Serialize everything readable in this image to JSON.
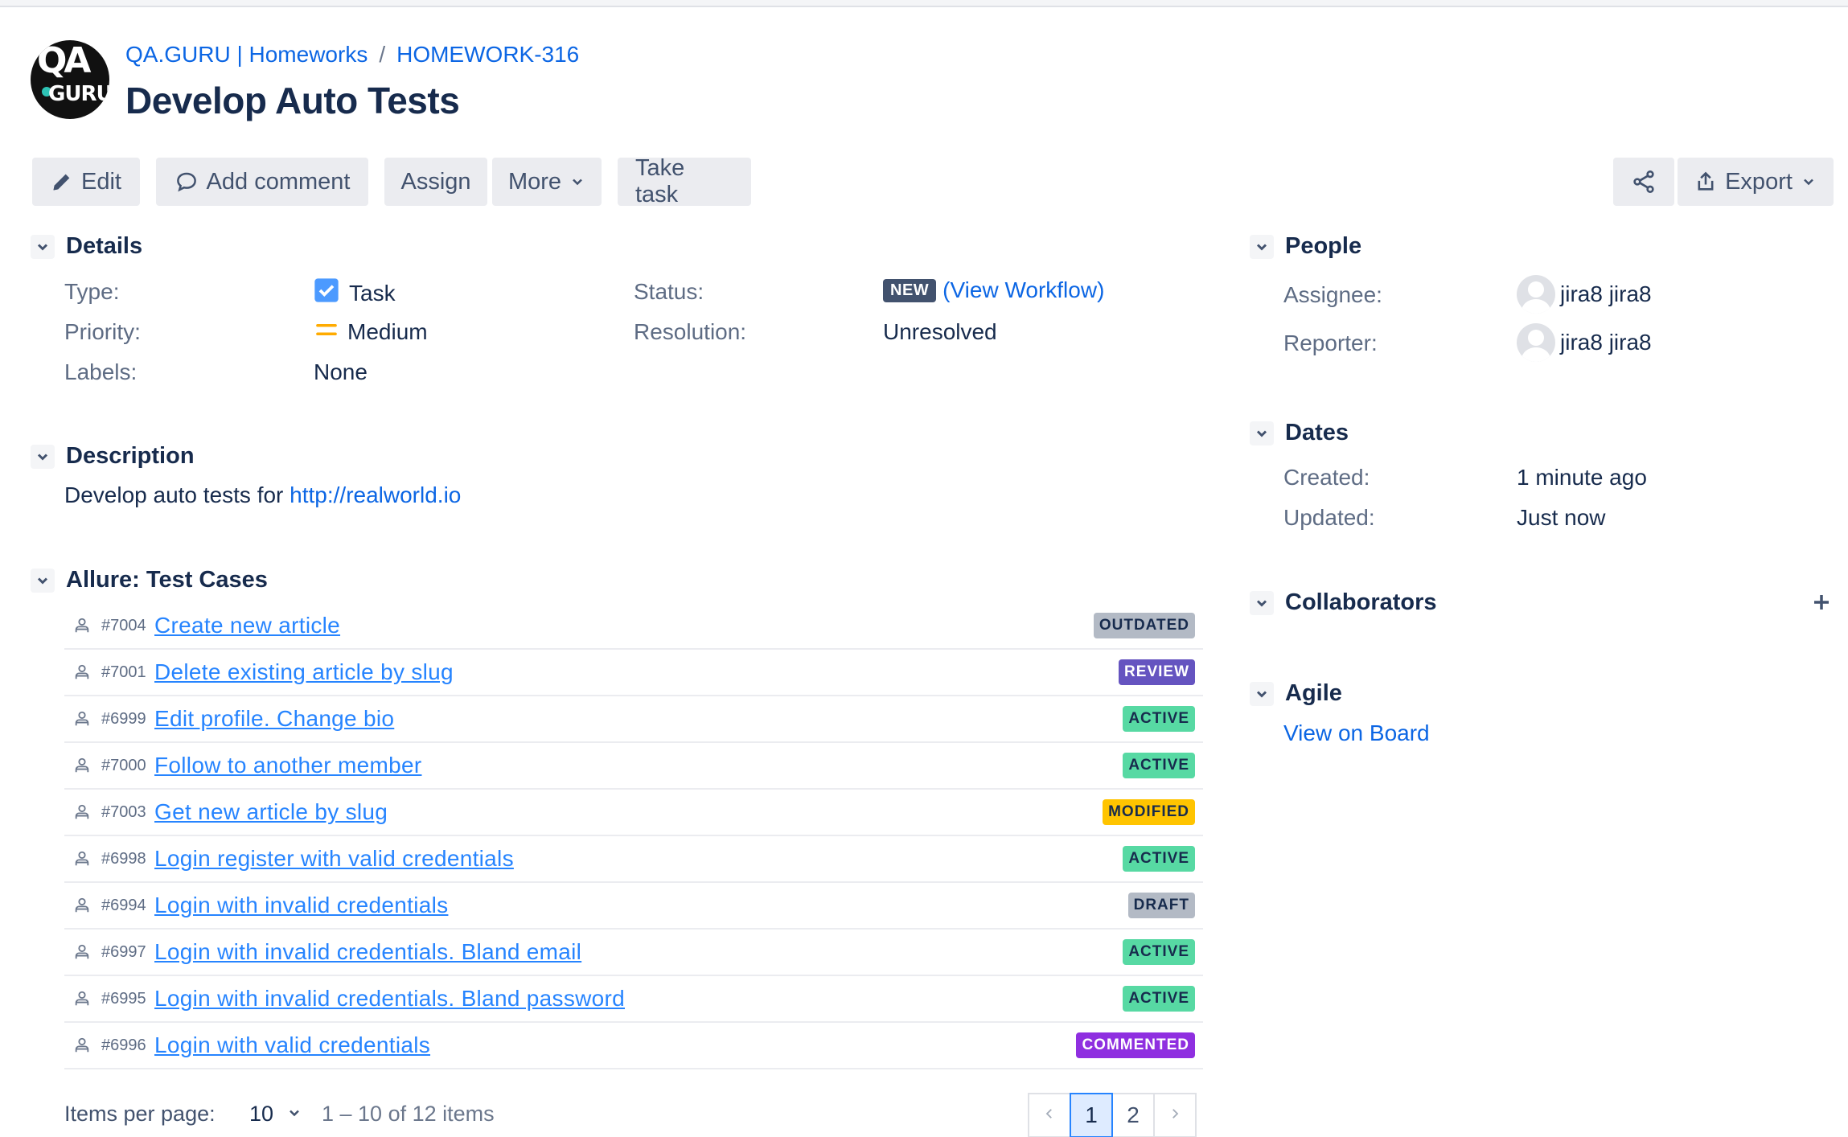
{
  "breadcrumb": {
    "project": "QA.GURU | Homeworks",
    "separator": "/",
    "issue_key": "HOMEWORK-316"
  },
  "project_avatar": {
    "text_top": "QA",
    "text_bottom": "GURU"
  },
  "title": "Develop Auto Tests",
  "toolbar": {
    "edit": "Edit",
    "add_comment": "Add comment",
    "assign": "Assign",
    "more": "More",
    "take_task": "Take task",
    "export": "Export"
  },
  "details": {
    "heading": "Details",
    "type_label": "Type:",
    "type_value": "Task",
    "priority_label": "Priority:",
    "priority_value": "Medium",
    "labels_label": "Labels:",
    "labels_value": "None",
    "status_label": "Status:",
    "status_value": "NEW",
    "workflow_open": "(",
    "workflow_link": "View Workflow",
    "workflow_close": ")",
    "resolution_label": "Resolution:",
    "resolution_value": "Unresolved"
  },
  "description": {
    "heading": "Description",
    "text": "Develop auto tests for ",
    "link": "http://realworld.io"
  },
  "allure": {
    "heading": "Allure: Test Cases",
    "rows": [
      {
        "id": "#7004",
        "name": "Create new article",
        "status": "OUTDATED"
      },
      {
        "id": "#7001",
        "name": "Delete existing article by slug",
        "status": "REVIEW"
      },
      {
        "id": "#6999",
        "name": "Edit profile. Change bio",
        "status": "ACTIVE"
      },
      {
        "id": "#7000",
        "name": "Follow to another member",
        "status": "ACTIVE"
      },
      {
        "id": "#7003",
        "name": "Get new article by slug",
        "status": "MODIFIED"
      },
      {
        "id": "#6998",
        "name": "Login register with valid credentials",
        "status": "ACTIVE"
      },
      {
        "id": "#6994",
        "name": "Login with invalid credentials",
        "status": "DRAFT"
      },
      {
        "id": "#6997",
        "name": "Login with invalid credentials. Bland email",
        "status": "ACTIVE"
      },
      {
        "id": "#6995",
        "name": "Login with invalid credentials. Bland password",
        "status": "ACTIVE"
      },
      {
        "id": "#6996",
        "name": "Login with valid credentials",
        "status": "COMMENTED"
      }
    ],
    "status_colors": {
      "OUTDATED": {
        "bg": "#b3bac5",
        "fg": "#172b4d"
      },
      "REVIEW": {
        "bg": "#6554c0",
        "fg": "#ffffff"
      },
      "ACTIVE": {
        "bg": "#57d9a3",
        "fg": "#172b4d"
      },
      "MODIFIED": {
        "bg": "#ffc400",
        "fg": "#172b4d"
      },
      "DRAFT": {
        "bg": "#b3bac5",
        "fg": "#172b4d"
      },
      "COMMENTED": {
        "bg": "#8f2fe0",
        "fg": "#ffffff"
      }
    },
    "items_per_page_label": "Items per page:",
    "items_per_page_value": "10",
    "range_text": "1 – 10 of 12 items",
    "pages": [
      "1",
      "2"
    ],
    "current_page": "1"
  },
  "people": {
    "heading": "People",
    "assignee_label": "Assignee:",
    "assignee": "jira8 jira8",
    "reporter_label": "Reporter:",
    "reporter": "jira8 jira8"
  },
  "dates": {
    "heading": "Dates",
    "created_label": "Created:",
    "created": "1 minute ago",
    "updated_label": "Updated:",
    "updated": "Just now"
  },
  "collaborators": {
    "heading": "Collaborators"
  },
  "agile": {
    "heading": "Agile",
    "link": "View on Board"
  },
  "colors": {
    "link": "#0c66e4",
    "task_icon": "#4c9aff",
    "priority_medium": "#ffab00"
  }
}
